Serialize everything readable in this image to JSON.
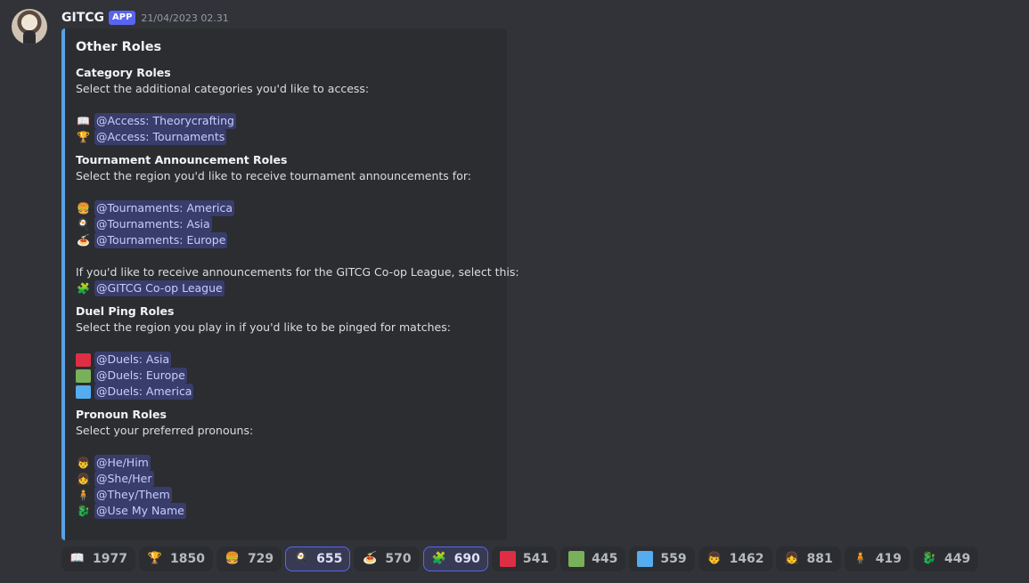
{
  "message": {
    "username": "GITCG",
    "badge": "APP",
    "timestamp": "21/04/2023 02.31"
  },
  "embed": {
    "title": "Other Roles",
    "accent_color": "#5aa2e5",
    "category": {
      "title": "Category Roles",
      "description": "Select the additional categories you'd like to access:",
      "roles": [
        {
          "icon": "open-book-icon",
          "glyph": "📖",
          "label": "@Access: Theorycrafting"
        },
        {
          "icon": "trophy-icon",
          "glyph": "🏆",
          "label": "@Access: Tournaments"
        }
      ]
    },
    "tournament": {
      "title": "Tournament Announcement Roles",
      "description": "Select the region you'd like to receive tournament announcements for:",
      "roles": [
        {
          "icon": "hamburger-icon",
          "glyph": "🍔",
          "label": "@Tournaments: America"
        },
        {
          "icon": "omelette-icon",
          "glyph": "🍳",
          "label": "@Tournaments: Asia"
        },
        {
          "icon": "pasta-icon",
          "glyph": "🍝",
          "label": "@Tournaments: Europe"
        }
      ],
      "coop_text": "If you'd like to receive announcements for the GITCG Co-op League, select this:",
      "coop_role": {
        "icon": "coop-icon",
        "glyph": "🧩",
        "label": "@GITCG Co-op League"
      }
    },
    "duel": {
      "title": "Duel Ping Roles",
      "description": "Select the region you play in if you'd like to be pinged for matches:",
      "roles": [
        {
          "icon": "red-square-icon",
          "color": "#dd2e44",
          "label": "@Duels: Asia"
        },
        {
          "icon": "green-square-icon",
          "color": "#78b159",
          "label": "@Duels: Europe"
        },
        {
          "icon": "blue-square-icon",
          "color": "#55acee",
          "label": "@Duels: America"
        }
      ]
    },
    "pronoun": {
      "title": "Pronoun Roles",
      "description": "Select your preferred pronouns:",
      "roles": [
        {
          "icon": "he-him-character-icon",
          "glyph": "👦",
          "label": "@He/Him"
        },
        {
          "icon": "she-her-character-icon",
          "glyph": "👧",
          "label": "@She/Her"
        },
        {
          "icon": "they-them-character-icon",
          "glyph": "🧍",
          "label": "@They/Them"
        },
        {
          "icon": "use-my-name-character-icon",
          "glyph": "🐉",
          "label": "@Use My Name"
        }
      ]
    }
  },
  "reactions": [
    {
      "icon": "open-book-icon",
      "glyph": "📖",
      "count": "1977",
      "active": false
    },
    {
      "icon": "trophy-icon",
      "glyph": "🏆",
      "count": "1850",
      "active": false
    },
    {
      "icon": "hamburger-icon",
      "glyph": "🍔",
      "count": "729",
      "active": false
    },
    {
      "icon": "omelette-icon",
      "glyph": "🍳",
      "count": "655",
      "active": true
    },
    {
      "icon": "pasta-icon",
      "glyph": "🍝",
      "count": "570",
      "active": false
    },
    {
      "icon": "coop-icon",
      "glyph": "🧩",
      "count": "690",
      "active": true
    },
    {
      "icon": "red-square-icon",
      "color": "#dd2e44",
      "count": "541",
      "active": false
    },
    {
      "icon": "green-square-icon",
      "color": "#78b159",
      "count": "445",
      "active": false
    },
    {
      "icon": "blue-square-icon",
      "color": "#55acee",
      "count": "559",
      "active": false
    },
    {
      "icon": "he-him-character-icon",
      "glyph": "👦",
      "count": "1462",
      "active": false
    },
    {
      "icon": "she-her-character-icon",
      "glyph": "👧",
      "count": "881",
      "active": false
    },
    {
      "icon": "they-them-character-icon",
      "glyph": "🧍",
      "count": "419",
      "active": false
    },
    {
      "icon": "use-my-name-character-icon",
      "glyph": "🐉",
      "count": "449",
      "active": false
    }
  ]
}
